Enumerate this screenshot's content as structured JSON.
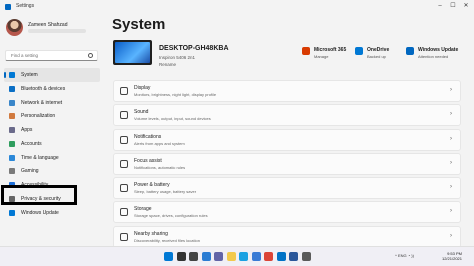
{
  "window": {
    "title": "Settings",
    "minimize": "–",
    "maximize": "☐",
    "close": "✕"
  },
  "user": {
    "name": "Zameen Shahzad"
  },
  "search": {
    "placeholder": "Find a setting"
  },
  "nav": [
    {
      "label": "System",
      "icon": "monitor-icon",
      "color": "#0078d4"
    },
    {
      "label": "Bluetooth & devices",
      "icon": "bluetooth-icon",
      "color": "#0b6fc5"
    },
    {
      "label": "Network & internet",
      "icon": "wifi-icon",
      "color": "#3a86c9"
    },
    {
      "label": "Personalization",
      "icon": "brush-icon",
      "color": "#d17a3f"
    },
    {
      "label": "Apps",
      "icon": "apps-icon",
      "color": "#6a6a8a"
    },
    {
      "label": "Accounts",
      "icon": "person-icon",
      "color": "#2e9d5e"
    },
    {
      "label": "Time & language",
      "icon": "globe-icon",
      "color": "#2b88d8"
    },
    {
      "label": "Gaming",
      "icon": "controller-icon",
      "color": "#7a7a7a"
    },
    {
      "label": "Accessibility",
      "icon": "accessibility-icon",
      "color": "#1e6fd9"
    },
    {
      "label": "Privacy & security",
      "icon": "shield-icon",
      "color": "#666666"
    },
    {
      "label": "Windows Update",
      "icon": "update-icon",
      "color": "#0078d4"
    }
  ],
  "main": {
    "title": "System",
    "device": {
      "name": "DESKTOP-GH48KBA",
      "model": "Inspiron 5406 2n1",
      "rename": "Rename"
    },
    "quick": [
      {
        "title": "Microsoft 365",
        "sub": "Manage",
        "icon": "microsoft365-icon",
        "color": "#d83b01"
      },
      {
        "title": "OneDrive",
        "sub": "Backed up",
        "icon": "cloud-icon",
        "color": "#0078d4"
      },
      {
        "title": "Windows Update",
        "sub": "Attention needed",
        "icon": "update-icon",
        "color": "#0067c0"
      }
    ],
    "cards": [
      {
        "title": "Display",
        "sub": "Monitors, brightness, night light, display profile",
        "icon": "display-icon"
      },
      {
        "title": "Sound",
        "sub": "Volume levels, output, input, sound devices",
        "icon": "speaker-icon"
      },
      {
        "title": "Notifications",
        "sub": "Alerts from apps and system",
        "icon": "bell-icon"
      },
      {
        "title": "Focus assist",
        "sub": "Notifications, automatic rules",
        "icon": "moon-icon"
      },
      {
        "title": "Power & battery",
        "sub": "Sleep, battery usage, battery saver",
        "icon": "power-icon"
      },
      {
        "title": "Storage",
        "sub": "Storage space, drives, configuration rules",
        "icon": "storage-icon"
      },
      {
        "title": "Nearby sharing",
        "sub": "Discoverability, received files location",
        "icon": "share-icon"
      }
    ],
    "chevron": "›"
  },
  "taskbar": {
    "apps": [
      {
        "name": "start-icon",
        "color": "#0078d4"
      },
      {
        "name": "search-icon",
        "color": "#333333"
      },
      {
        "name": "taskview-icon",
        "color": "#444444"
      },
      {
        "name": "widgets-icon",
        "color": "#2b7cd3"
      },
      {
        "name": "chat-icon",
        "color": "#6264a7"
      },
      {
        "name": "explorer-icon",
        "color": "#f2c94c"
      },
      {
        "name": "edge-icon",
        "color": "#1ba1e2"
      },
      {
        "name": "store-icon",
        "color": "#3a7bd5"
      },
      {
        "name": "chrome-icon",
        "color": "#db4437"
      },
      {
        "name": "mail-icon",
        "color": "#0072c6"
      },
      {
        "name": "word-icon",
        "color": "#2b579a"
      },
      {
        "name": "settings-icon",
        "color": "#5a5a5a"
      }
    ],
    "time": "9:53 PM",
    "date": "12/21/2021",
    "tray": "^  ENG  ◔ ))"
  }
}
